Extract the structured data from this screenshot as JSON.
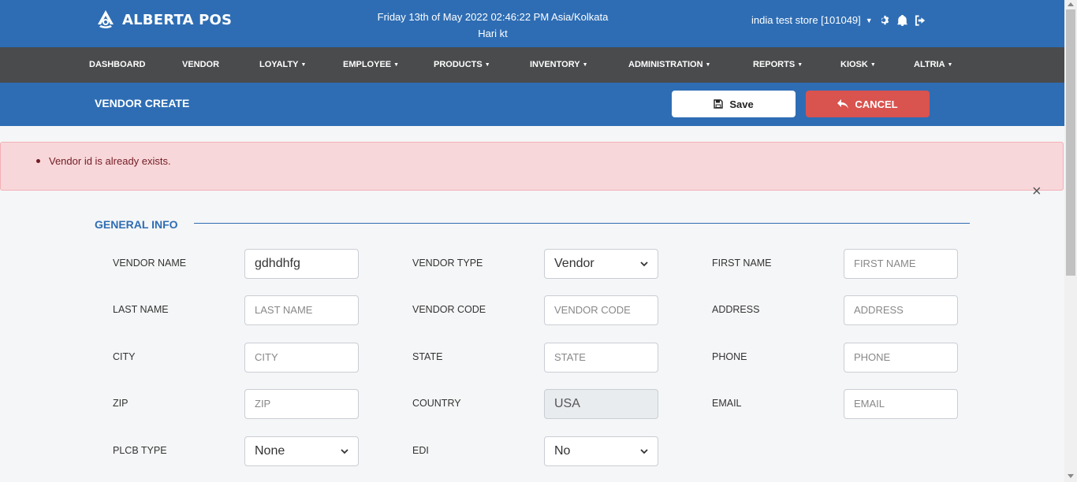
{
  "header": {
    "logo_text": "ALBERTA POS",
    "datetime": "Friday 13th of May 2022 02:46:22 PM Asia/Kolkata",
    "user": "Hari kt",
    "store": "india test store [101049]"
  },
  "nav": [
    {
      "label": "DASHBOARD",
      "dropdown": false
    },
    {
      "label": "VENDOR",
      "dropdown": false
    },
    {
      "label": "LOYALTY",
      "dropdown": true
    },
    {
      "label": "EMPLOYEE",
      "dropdown": true
    },
    {
      "label": "PRODUCTS",
      "dropdown": true
    },
    {
      "label": "INVENTORY",
      "dropdown": true
    },
    {
      "label": "ADMINISTRATION",
      "dropdown": true
    },
    {
      "label": "REPORTS",
      "dropdown": true
    },
    {
      "label": "KIOSK",
      "dropdown": true
    },
    {
      "label": "ALTRIA",
      "dropdown": true
    }
  ],
  "page": {
    "title": "VENDOR CREATE",
    "save_label": "Save",
    "cancel_label": "CANCEL"
  },
  "alert": {
    "message": "Vendor id is already exists.",
    "close": "×"
  },
  "section": {
    "title": "GENERAL INFO"
  },
  "form": {
    "vendor_name": {
      "label": "VENDOR NAME",
      "value": "gdhdhfg"
    },
    "vendor_type": {
      "label": "VENDOR TYPE",
      "selected": "Vendor"
    },
    "first_name": {
      "label": "FIRST NAME",
      "placeholder": "FIRST NAME"
    },
    "last_name": {
      "label": "LAST NAME",
      "placeholder": "LAST NAME"
    },
    "vendor_code": {
      "label": "VENDOR CODE",
      "placeholder": "VENDOR CODE"
    },
    "address": {
      "label": "ADDRESS",
      "placeholder": "ADDRESS"
    },
    "city": {
      "label": "CITY",
      "placeholder": "CITY"
    },
    "state": {
      "label": "STATE",
      "placeholder": "STATE"
    },
    "phone": {
      "label": "PHONE",
      "placeholder": "PHONE"
    },
    "zip": {
      "label": "ZIP",
      "placeholder": "ZIP"
    },
    "country": {
      "label": "COUNTRY",
      "value": "USA"
    },
    "email": {
      "label": "EMAIL",
      "placeholder": "EMAIL"
    },
    "plcb_type": {
      "label": "PLCB TYPE",
      "selected": "None"
    },
    "edi": {
      "label": "EDI",
      "selected": "No"
    }
  },
  "colors": {
    "primary": "#2e6db4",
    "navbar": "#4a4b4d",
    "danger": "#d9534f",
    "alert_bg": "#f8d7da"
  }
}
